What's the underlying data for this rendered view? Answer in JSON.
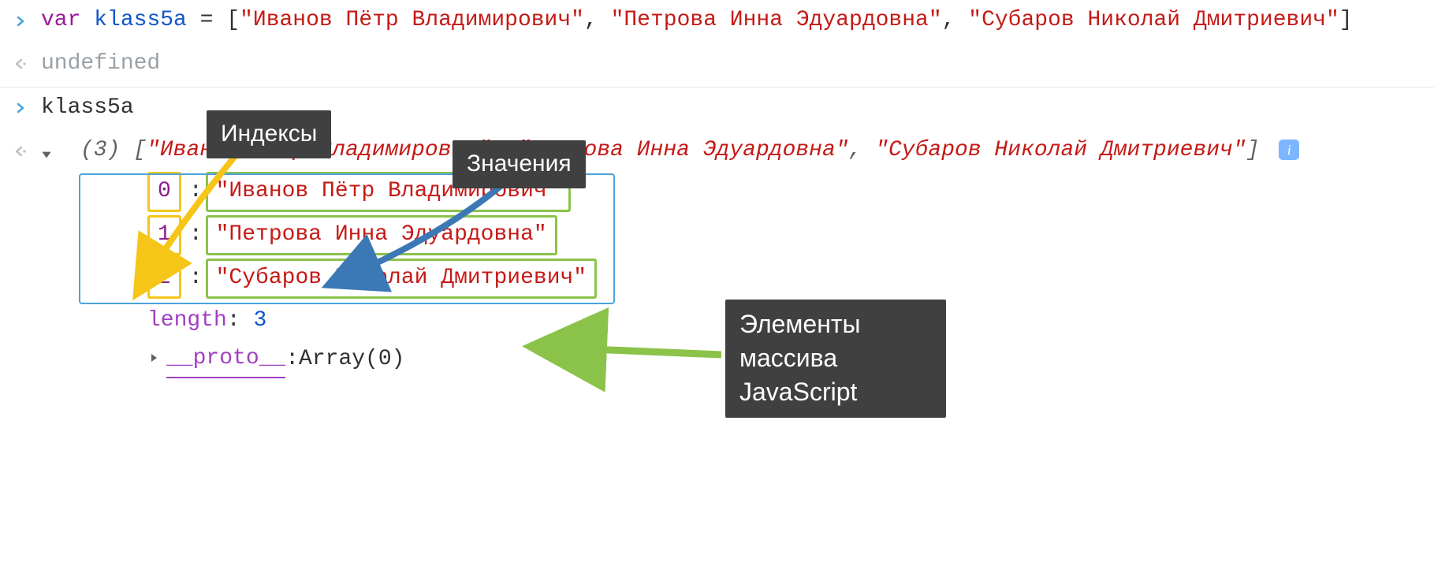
{
  "input1": {
    "kw": "var",
    "ident": "klass5a",
    "eq": " = ",
    "open": "[",
    "s0": "\"Иванов Пётр Владимирович\"",
    "c1": ", ",
    "s1": "\"Петрова Инна Эдуардовна\"",
    "c2": ", ",
    "s2": "\"Субаров Николай Дмитриевич\"",
    "close": "]"
  },
  "out1": {
    "text": "undefined"
  },
  "input2": {
    "ident": "klass5a"
  },
  "summary": {
    "count": "(3) ",
    "open": "[",
    "s0": "\"Иванов Пётр Владимирович\"",
    "c1": ", ",
    "s1": "\"Петрова Инна Эдуардовна\"",
    "c2": ", ",
    "s2": "\"Субаров Николай Дмитриевич\"",
    "close": "]",
    "info": "i"
  },
  "elems": {
    "i0": "0",
    "v0": "\"Иванов Пётр Владимирович\"",
    "i1": "1",
    "v1": "\"Петрова Инна Эдуардовна\"",
    "i2": "2",
    "v2": "\"Субаров Николай Дмитриевич\""
  },
  "length": {
    "label": "length",
    "sep": ": ",
    "val": "3"
  },
  "proto": {
    "label": "__proto__",
    "sep": ": ",
    "val": "Array(0)"
  },
  "anno": {
    "indexes": "Индексы",
    "values": "Значения",
    "elements": "Элементы массива JavaScript"
  }
}
